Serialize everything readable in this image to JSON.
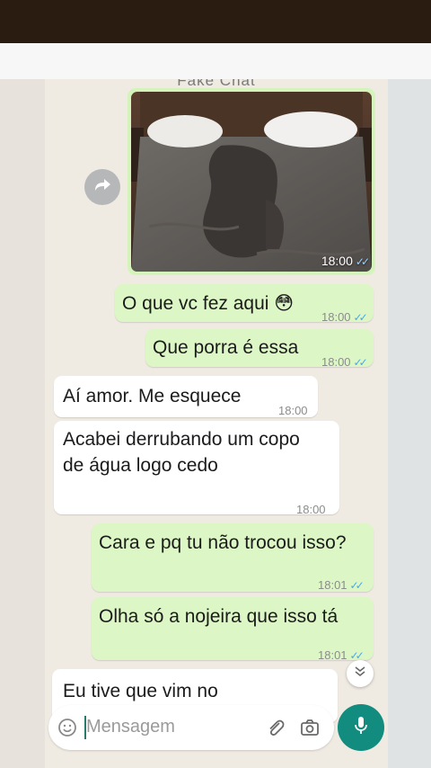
{
  "chat": {
    "title": "Fake Chat",
    "photo_time": "18:00",
    "messages": [
      {
        "text": "O que vc fez aqui 😳",
        "time": "18:00",
        "ticks": "✓✓"
      },
      {
        "text": "Que porra é essa",
        "time": "18:00",
        "ticks": "✓✓"
      },
      {
        "text": "Aí amor. Me esquece",
        "time": "18:00"
      },
      {
        "text": "Acabei derrubando um copo de água logo cedo",
        "time": "18:00"
      },
      {
        "text": "Cara e pq tu não trocou isso?",
        "time": "18:01",
        "ticks": "✓✓"
      },
      {
        "text": "Olha só a nojeira que isso tá",
        "time": "18:01",
        "ticks": "✓✓"
      },
      {
        "text": "Eu tive que vim no"
      }
    ]
  },
  "composer": {
    "placeholder": "Mensagem"
  },
  "icons": {
    "forward": "forward-icon",
    "scroll_down": "double-chevron-down-icon",
    "emoji": "emoji-icon",
    "attach": "paperclip-icon",
    "camera": "camera-icon",
    "mic": "microphone-icon"
  },
  "colors": {
    "outgoing_bubble": "#dcf7c5",
    "incoming_bubble": "#ffffff",
    "chat_background": "#efeae2",
    "read_ticks": "#4fa7dd",
    "mic_button": "#128c7e"
  }
}
